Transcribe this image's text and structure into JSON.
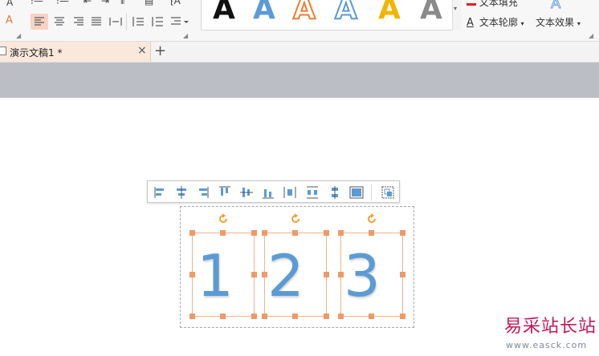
{
  "ribbon": {
    "text_fill_label": "文本填充",
    "text_outline_label": "文本轮廓",
    "text_effect_label": "文本效果",
    "wordart_styles": [
      {
        "name": "black",
        "glyph": "A",
        "color": "#111111"
      },
      {
        "name": "blue",
        "glyph": "A",
        "color": "#5b9bd5"
      },
      {
        "name": "orange-outline",
        "glyph": "A",
        "color": "#ed7d31"
      },
      {
        "name": "blue-outline",
        "glyph": "A",
        "color": "#5b9bd5"
      },
      {
        "name": "gold",
        "glyph": "A",
        "color": "#f2b400"
      },
      {
        "name": "grey-gradient",
        "glyph": "A",
        "color": "#7f7f7f"
      }
    ]
  },
  "tabs": {
    "doc_title": "演示文稿1 *",
    "close_glyph": "×",
    "new_tab_glyph": "+"
  },
  "slide": {
    "digits": [
      "1",
      "2",
      "3"
    ],
    "digit_color": "#5b9bd5",
    "handle_color": "#ef9a66",
    "rotate_color": "#f0a030"
  },
  "align_toolbar": {
    "buttons": [
      "align-left",
      "align-center",
      "align-right",
      "align-top",
      "align-middle",
      "align-bottom",
      "distribute-horizontal",
      "distribute-horizontal-alt",
      "distribute-vertical",
      "fit-to-slide",
      "group"
    ]
  },
  "watermark": {
    "title": "易采站长站",
    "url": "www.easck.com"
  }
}
